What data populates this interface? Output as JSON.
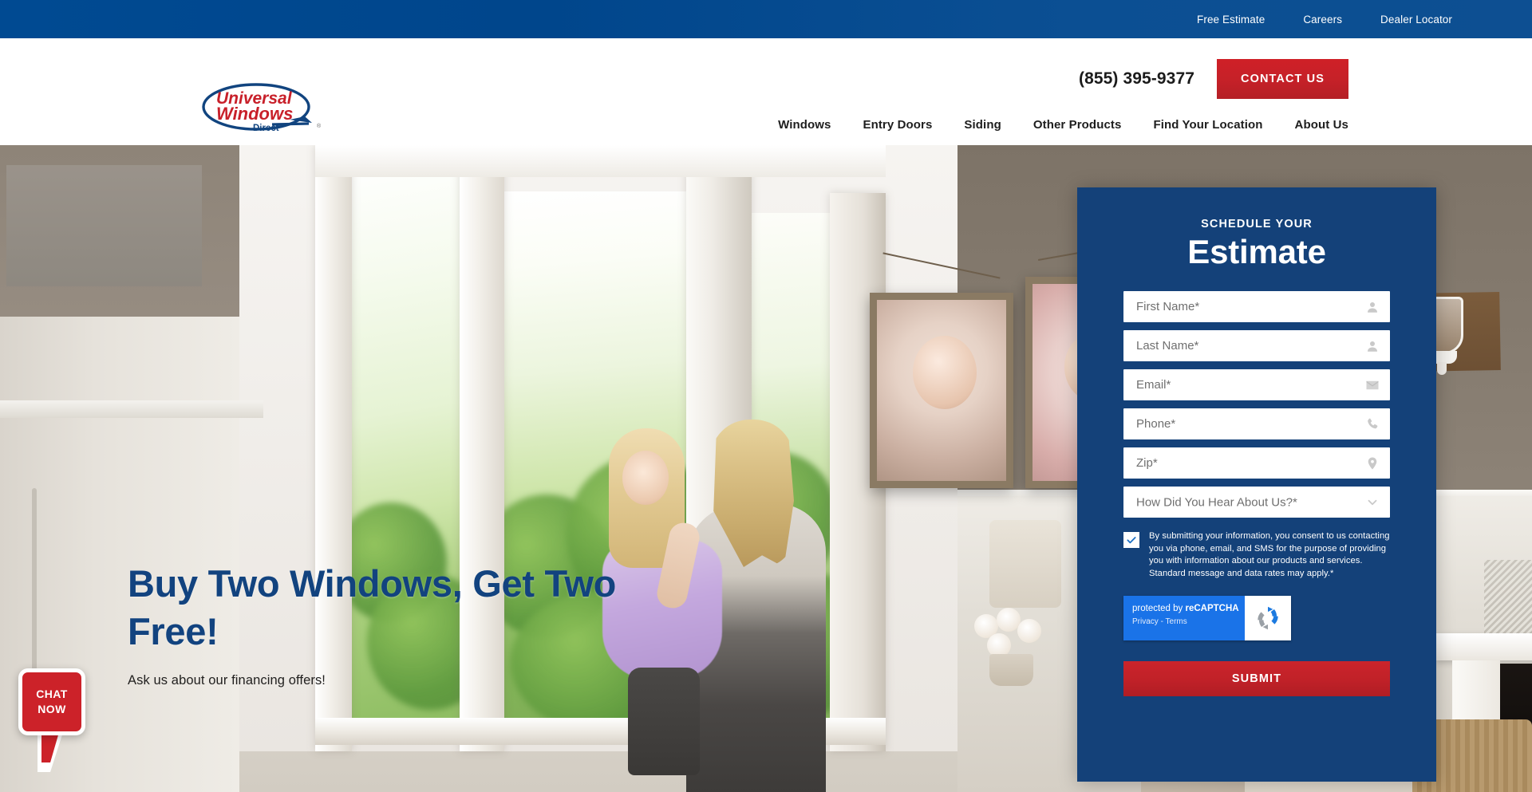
{
  "topbar": {
    "links": [
      {
        "label": "Free Estimate"
      },
      {
        "label": "Careers"
      },
      {
        "label": "Dealer Locator"
      }
    ]
  },
  "header": {
    "logo": {
      "line1": "Universal",
      "line2": "Windows",
      "line3": "Direct",
      "trademark": "®"
    },
    "phone": "(855) 395-9377",
    "contact_label": "CONTACT US",
    "nav": [
      {
        "label": "Windows"
      },
      {
        "label": "Entry Doors"
      },
      {
        "label": "Siding"
      },
      {
        "label": "Other Products"
      },
      {
        "label": "Find Your Location"
      },
      {
        "label": "About Us"
      }
    ]
  },
  "hero": {
    "headline": "Buy Two Windows, Get Two Free!",
    "subtext": "Ask us about our financing offers!"
  },
  "form": {
    "kicker": "SCHEDULE YOUR",
    "title": "Estimate",
    "fields": [
      {
        "placeholder": "First Name*",
        "icon": "person-icon"
      },
      {
        "placeholder": "Last Name*",
        "icon": "person-icon"
      },
      {
        "placeholder": "Email*",
        "icon": "envelope-icon"
      },
      {
        "placeholder": "Phone*",
        "icon": "phone-icon"
      },
      {
        "placeholder": "Zip*",
        "icon": "location-pin-icon"
      }
    ],
    "select": {
      "placeholder": "How Did You Hear About Us?*",
      "icon": "chevron-down-icon"
    },
    "consent": "By submitting your information, you consent to us contacting you via phone, email, and SMS for the purpose of providing you with information about our products and services. Standard message and data rates may apply.*",
    "consent_checked": true,
    "recaptcha": {
      "line1_prefix": "protected by ",
      "line1_brand": "reCAPTCHA",
      "privacy": "Privacy",
      "separator": " - ",
      "terms": "Terms"
    },
    "submit_label": "SUBMIT"
  },
  "chat": {
    "line1": "CHAT",
    "line2": "NOW"
  },
  "colors": {
    "brand_blue": "#004a92",
    "panel_blue": "#144179",
    "brand_red": "#c02128",
    "headline_blue": "#12437f",
    "recaptcha_blue": "#1a73e8"
  }
}
